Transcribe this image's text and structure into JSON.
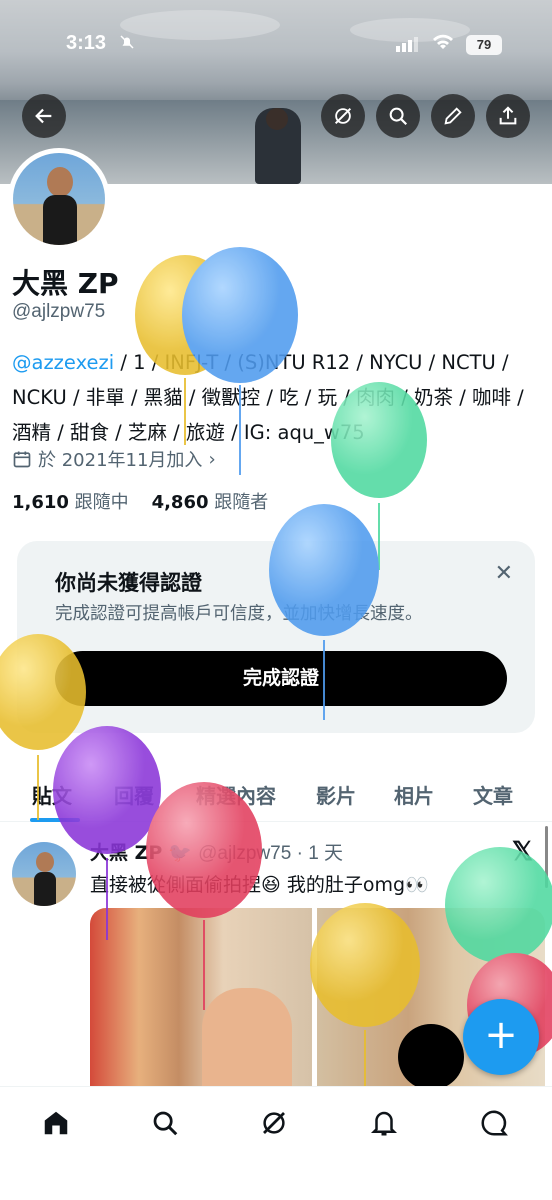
{
  "status_bar": {
    "time": "3:13",
    "battery": "79"
  },
  "profile": {
    "name": "大黑 ZP",
    "handle": "@ajlzpw75",
    "bio_mention": "@azzexezi",
    "bio_rest": " / 1 / INFJ-T / (S)NTU R12 / NYCU / NCTU / NCKU / 非單 / 黑貓 / 徵獸控 / 吃 / 玩 / 肉肉 / 奶茶 / 咖啡 / 酒精 / 甜食 / 芝麻 / 旅遊 / IG: aqu_w75",
    "joined": "於 2021年11月加入",
    "following_count": "1,610",
    "following_label": "跟隨中",
    "followers_count": "4,860",
    "followers_label": "跟隨者"
  },
  "verify_card": {
    "title": "你尚未獲得認證",
    "subtitle": "完成認證可提高帳戶可信度，並加快增長速度。",
    "cta": "完成認證"
  },
  "tabs": [
    "貼文",
    "回覆",
    "精選內容",
    "影片",
    "相片",
    "文章"
  ],
  "post": {
    "name": "大黑 ZP",
    "meta": "@ajlzpw75 · 1 天",
    "text": "直接被從側面偷拍捏😆 我的肚子omg👀"
  },
  "colors": {
    "accent": "#1d9bf0",
    "text": "#0f1419",
    "muted": "#536471"
  },
  "icons": [
    "back-arrow-icon",
    "grok-icon",
    "search-icon",
    "edit-icon",
    "share-icon",
    "calendar-icon",
    "close-icon",
    "home-icon",
    "bell-icon",
    "messages-icon",
    "x-logo-icon",
    "plus-icon"
  ]
}
